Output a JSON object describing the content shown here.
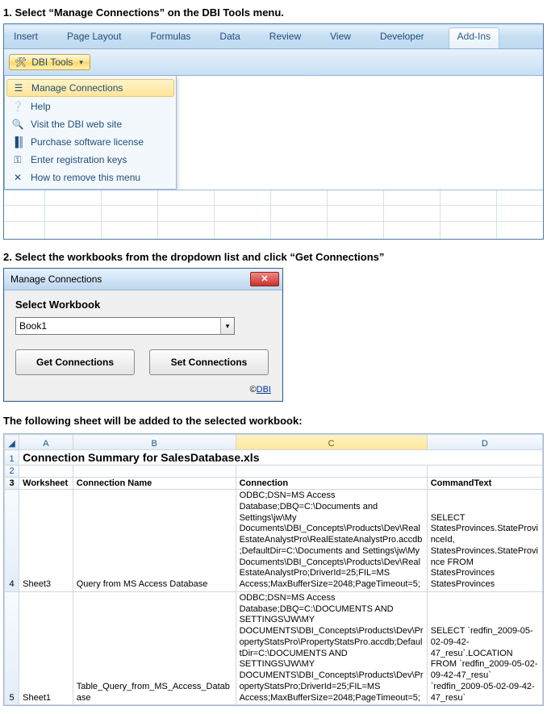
{
  "step1": {
    "title": "1.  Select “Manage Connections” on the DBI Tools menu.",
    "ribbon_tabs": [
      "Insert",
      "Page Layout",
      "Formulas",
      "Data",
      "Review",
      "View",
      "Developer",
      "Add-Ins"
    ],
    "dbi_button": "DBI Tools",
    "menu": [
      {
        "name": "manage-connections",
        "label": "Manage Connections",
        "highlight": true
      },
      {
        "name": "help",
        "label": "Help",
        "highlight": false
      },
      {
        "name": "visit-site",
        "label": "Visit the DBI web site",
        "highlight": false
      },
      {
        "name": "purchase",
        "label": "Purchase software license",
        "highlight": false
      },
      {
        "name": "register",
        "label": "Enter registration keys",
        "highlight": false
      },
      {
        "name": "remove-menu",
        "label": "How to remove this menu",
        "highlight": false
      }
    ]
  },
  "step2": {
    "title": "2.  Select the workbooks from the dropdown list and click “Get Connections”",
    "dialog_title": "Manage Connections",
    "select_label": "Select Workbook",
    "combo_value": "Book1",
    "get_btn": "Get Connections",
    "set_btn": "Set Connections",
    "credit_prefix": "©",
    "credit_link": "DBI"
  },
  "sheet_intro": "The following sheet will be added to the selected workbook:",
  "worksheet": {
    "columns": [
      "A",
      "B",
      "C",
      "D"
    ],
    "title": "Connection Summary for SalesDatabase.xls",
    "headers": {
      "A": "Worksheet",
      "B": "Connection Name",
      "C": "Connection",
      "D": "CommandText"
    },
    "rows": [
      {
        "n": "4",
        "A": "Sheet3",
        "B": "Query from MS Access Database",
        "C": "ODBC;DSN=MS Access Database;DBQ=C:\\Documents and Settings\\jw\\My Documents\\DBI_Concepts\\Products\\Dev\\RealEstateAnalystPro\\RealEstateAnalystPro.accdb;DefaultDir=C:\\Documents and Settings\\jw\\My Documents\\DBI_Concepts\\Products\\Dev\\RealEstateAnalystPro;DriverId=25;FIL=MS Access;MaxBufferSize=2048;PageTimeout=5;",
        "D": "SELECT StatesProvinces.StateProvinceId, StatesProvinces.StateProvince FROM StatesProvinces StatesProvinces"
      },
      {
        "n": "5",
        "A": "Sheet1",
        "B": "Table_Query_from_MS_Access_Database",
        "C": "ODBC;DSN=MS Access Database;DBQ=C:\\DOCUMENTS AND SETTINGS\\JW\\MY DOCUMENTS\\DBI_Concepts\\Products\\Dev\\PropertyStatsPro\\PropertyStatsPro.accdb;DefaultDir=C:\\DOCUMENTS AND SETTINGS\\JW\\MY DOCUMENTS\\DBI_Concepts\\Products\\Dev\\PropertyStatsPro;DriverId=25;FIL=MS Access;MaxBufferSize=2048;PageTimeout=5;",
        "D": "SELECT `redfin_2009-05-02-09-42-47_resu`.LOCATION FROM `redfin_2009-05-02-09-42-47_resu` `redfin_2009-05-02-09-42-47_resu`"
      }
    ]
  }
}
